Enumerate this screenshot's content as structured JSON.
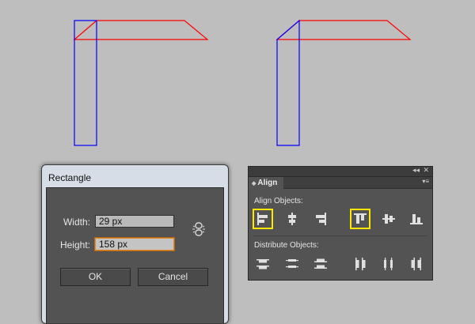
{
  "dialog": {
    "title": "Rectangle",
    "width_label": "Width:",
    "width_value": "29 px",
    "height_label": "Height:",
    "height_value": "158 px",
    "ok_label": "OK",
    "cancel_label": "Cancel"
  },
  "align_panel": {
    "tab_label": "Align",
    "collapse_glyph": "◂◂",
    "close_glyph": "✕",
    "menu_glyph": "▾≡",
    "align_objects_label": "Align Objects:",
    "distribute_objects_label": "Distribute Objects:",
    "align_icons": [
      {
        "name": "horizontal-align-left-icon",
        "highlighted": true
      },
      {
        "name": "horizontal-align-center-icon",
        "highlighted": false
      },
      {
        "name": "horizontal-align-right-icon",
        "highlighted": false
      },
      {
        "name": "vertical-align-top-icon",
        "highlighted": true
      },
      {
        "name": "vertical-align-center-icon",
        "highlighted": false
      },
      {
        "name": "vertical-align-bottom-icon",
        "highlighted": false
      }
    ],
    "distribute_icons": [
      {
        "name": "vertical-distribute-top-icon"
      },
      {
        "name": "vertical-distribute-center-icon"
      },
      {
        "name": "vertical-distribute-bottom-icon"
      },
      {
        "name": "horizontal-distribute-left-icon"
      },
      {
        "name": "horizontal-distribute-center-icon"
      },
      {
        "name": "horizontal-distribute-right-icon"
      }
    ]
  },
  "colors": {
    "canvas_bg": "#bebebe",
    "path_red": "#ff0000",
    "path_blue": "#0000ff",
    "highlight": "#ffe600"
  }
}
